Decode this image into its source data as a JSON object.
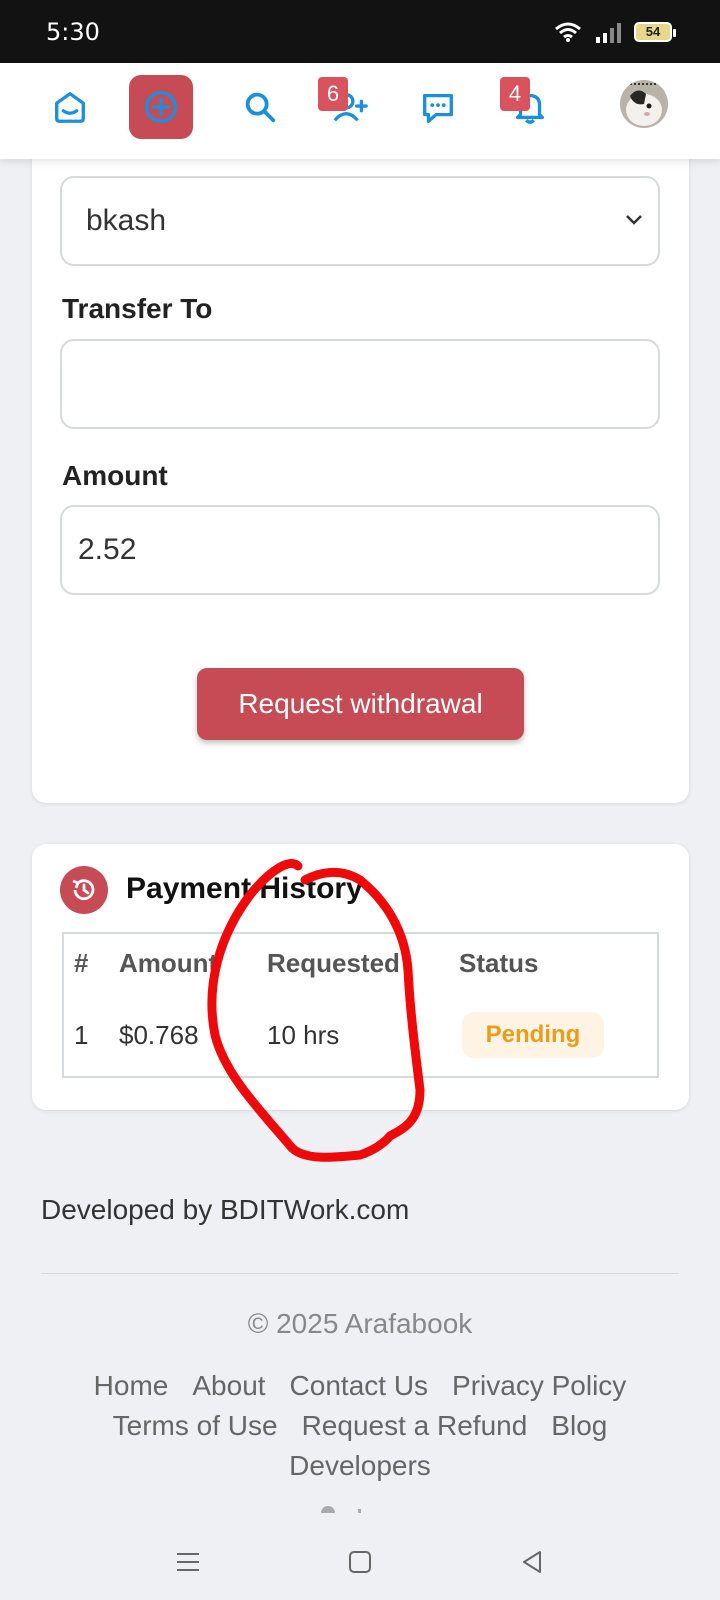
{
  "status_bar": {
    "time": "5:30",
    "battery": "54"
  },
  "nav": {
    "friend_requests_count": "6",
    "notifications_count": "4",
    "accent": "#1a8fe0",
    "brand": "#c64b55"
  },
  "withdraw_form": {
    "method_value": "bkash",
    "transfer_label": "Transfer To",
    "transfer_value": "",
    "amount_label": "Amount",
    "amount_value": "2.52",
    "submit_label": "Request withdrawal"
  },
  "payment_history": {
    "title": "Payment History",
    "columns": [
      "#",
      "Amount",
      "Requested",
      "Status"
    ],
    "rows": [
      {
        "num": "1",
        "amount": "$0.768",
        "requested": "10 hrs",
        "status": "Pending"
      }
    ]
  },
  "footer": {
    "developer": "Developed by BDITWork.com",
    "copyright": "© 2025 Arafabook",
    "links": [
      "Home",
      "About",
      "Contact Us",
      "Privacy Policy",
      "Terms of Use",
      "Request a Refund",
      "Blog",
      "Developers"
    ]
  }
}
